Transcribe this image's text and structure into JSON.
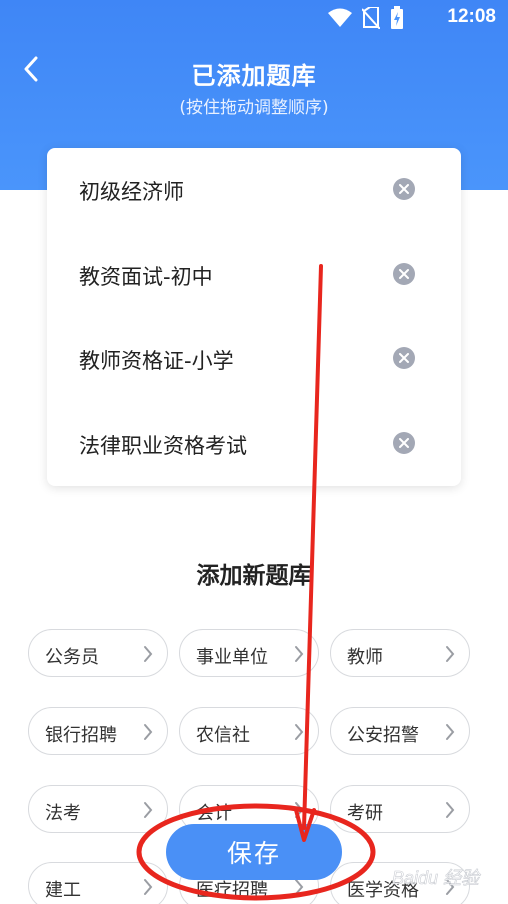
{
  "status_bar": {
    "time": "12:08"
  },
  "header": {
    "title": "已添加题库",
    "subtitle": "(按住拖动调整顺序)"
  },
  "added_banks": [
    {
      "label": "初级经济师"
    },
    {
      "label": "教资面试-初中"
    },
    {
      "label": "教师资格证-小学"
    },
    {
      "label": "法律职业资格考试"
    }
  ],
  "add_section": {
    "title": "添加新题库",
    "chips": [
      {
        "label": "公务员"
      },
      {
        "label": "事业单位"
      },
      {
        "label": "教师"
      },
      {
        "label": "银行招聘"
      },
      {
        "label": "农信社"
      },
      {
        "label": "公安招警"
      },
      {
        "label": "法考"
      },
      {
        "label": "会计"
      },
      {
        "label": "考研"
      },
      {
        "label": "建工"
      },
      {
        "label": "医疗招聘"
      },
      {
        "label": "医学资格"
      }
    ]
  },
  "save_label": "保存",
  "colors": {
    "header_blue": "#4a95fb",
    "save_button": "#4a90f6",
    "annotation_red": "#e8261e"
  },
  "watermark_text": "Baidu 经验"
}
